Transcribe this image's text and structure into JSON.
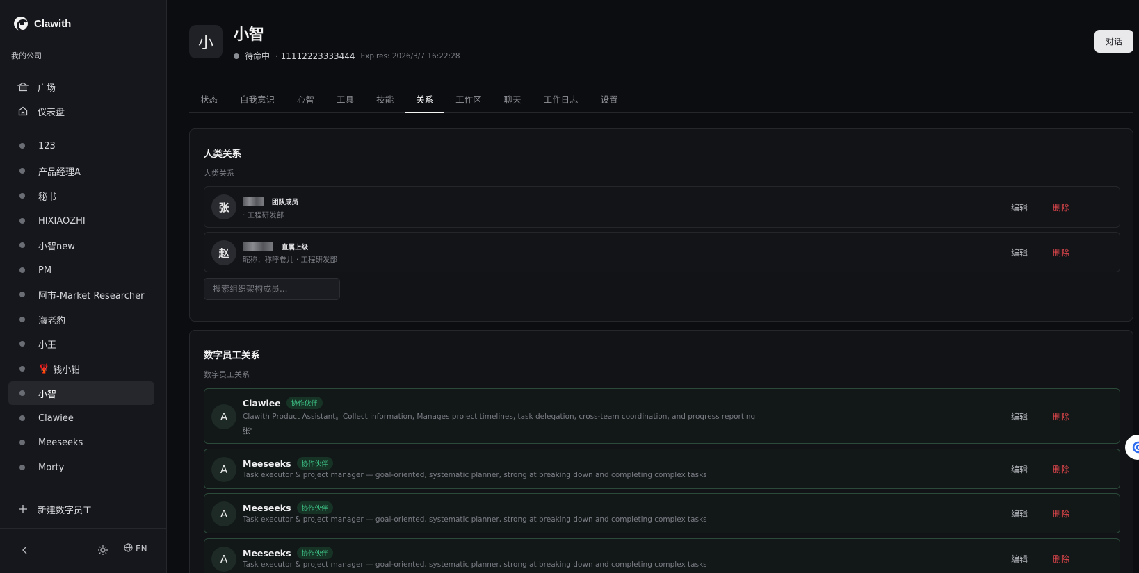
{
  "sidebar": {
    "brand": "Clawith",
    "company": "我的公司",
    "nav": [
      {
        "label": "广场",
        "icon": "bank-icon"
      },
      {
        "label": "仪表盘",
        "icon": "home-icon"
      }
    ],
    "agents": [
      {
        "label": "123"
      },
      {
        "label": "产品经理A"
      },
      {
        "label": "秘书"
      },
      {
        "label": "HIXIAOZHI"
      },
      {
        "label": "小智new"
      },
      {
        "label": "PM"
      },
      {
        "label": "阿市-Market Researcher"
      },
      {
        "label": "海老豹"
      },
      {
        "label": "小王"
      },
      {
        "label": "钱小钳",
        "emoji": "🦞"
      },
      {
        "label": "小智",
        "active": true
      },
      {
        "label": "Clawiee"
      },
      {
        "label": "Meeseeks"
      },
      {
        "label": "Morty"
      }
    ],
    "new_agent": "新建数字员工",
    "lang": "EN"
  },
  "header": {
    "avatar_char": "小",
    "name": "小智",
    "status": "待命中",
    "id": "· 11112223333444",
    "expires": "Expires: 2026/3/7 16:22:28",
    "chat_button": "对话"
  },
  "tabs": [
    "状态",
    "自我意识",
    "心智",
    "工具",
    "技能",
    "关系",
    "工作区",
    "聊天",
    "工作日志",
    "设置"
  ],
  "active_tab": "关系",
  "human": {
    "title": "人类关系",
    "subtitle": "人类关系",
    "rows": [
      {
        "avatar": "张",
        "role": "团队成员",
        "desc": "· 工程研发部"
      },
      {
        "avatar": "赵",
        "role": "直属上级",
        "desc": "昵称：称呼卷儿 · 工程研发部"
      }
    ],
    "search_placeholder": "搜索组织架构成员..."
  },
  "digital": {
    "title": "数字员工关系",
    "subtitle": "数字员工关系",
    "rows": [
      {
        "avatar": "A",
        "name": "Clawiee",
        "badge": "协作伙伴",
        "desc": "Clawith Product Assistant。Collect information, Manages project timelines, task delegation, cross-team coordination, and progress reporting",
        "extra": "张'"
      },
      {
        "avatar": "A",
        "name": "Meeseeks",
        "badge": "协作伙伴",
        "desc": "Task executor & project manager — goal-oriented, systematic planner, strong at breaking down and completing complex tasks"
      },
      {
        "avatar": "A",
        "name": "Meeseeks",
        "badge": "协作伙伴",
        "desc": "Task executor & project manager — goal-oriented, systematic planner, strong at breaking down and completing complex tasks"
      },
      {
        "avatar": "A",
        "name": "Meeseeks",
        "badge": "协作伙伴",
        "desc": "Task executor & project manager — goal-oriented, systematic planner, strong at breaking down and completing complex tasks"
      }
    ]
  },
  "actions": {
    "edit": "编辑",
    "delete": "删除"
  },
  "colors": {
    "accent_green": "#3fc98a",
    "danger": "#e5484d",
    "background": "#0c0d11"
  }
}
